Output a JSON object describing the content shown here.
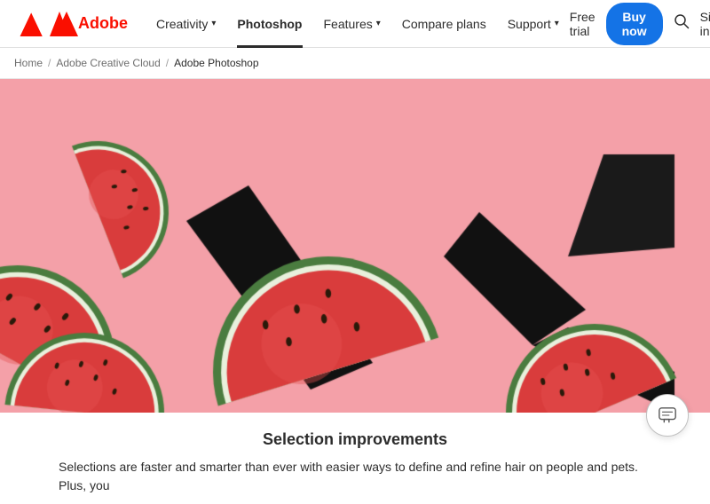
{
  "brand": {
    "logo_text": "Adobe",
    "logo_icon": "A"
  },
  "nav": {
    "items": [
      {
        "id": "creativity",
        "label": "Creativity",
        "has_dropdown": true,
        "active": false
      },
      {
        "id": "photoshop",
        "label": "Photoshop",
        "has_dropdown": false,
        "active": true
      },
      {
        "id": "features",
        "label": "Features",
        "has_dropdown": true,
        "active": false
      },
      {
        "id": "compare-plans",
        "label": "Compare plans",
        "has_dropdown": false,
        "active": false
      },
      {
        "id": "support",
        "label": "Support",
        "has_dropdown": true,
        "active": false
      }
    ],
    "free_trial_label": "Free trial",
    "buy_now_label": "Buy now",
    "sign_in_label": "Sign in"
  },
  "breadcrumb": {
    "home": "Home",
    "creative_cloud": "Adobe Creative Cloud",
    "current": "Adobe Photoshop"
  },
  "hero": {
    "alt": "Watermelon slices on pink background"
  },
  "content": {
    "title": "Selection improvements",
    "body": "Selections are faster and smarter than ever with easier ways to define and refine hair on people and pets. Plus, you"
  },
  "chat": {
    "label": "Chat support"
  },
  "colors": {
    "adobe_red": "#fa0f00",
    "buy_now_blue": "#1473e6",
    "active_underline": "#2c2c2c"
  }
}
